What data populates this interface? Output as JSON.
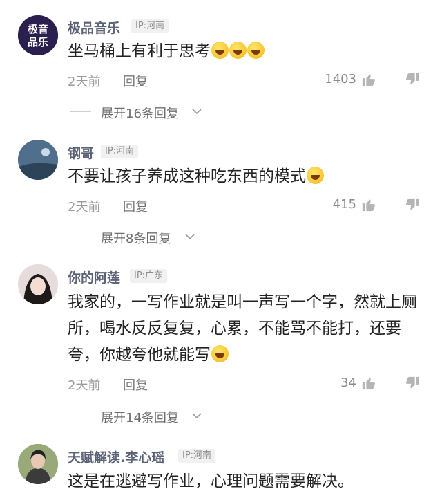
{
  "comments": [
    {
      "username": "极品音乐",
      "ip": "IP:河南",
      "text": "坐马桶上有利于思考",
      "emoji_count": 3,
      "time": "2天前",
      "reply_label": "回复",
      "likes": "1403",
      "expand_label": "展开16条回复",
      "avatar": {
        "line1": "极音",
        "line2": "品乐"
      }
    },
    {
      "username": "钢哥",
      "ip": "IP:河南",
      "text": "不要让孩子养成这种吃东西的模式",
      "emoji_count": 1,
      "time": "2天前",
      "reply_label": "回复",
      "likes": "415",
      "expand_label": "展开8条回复"
    },
    {
      "username": "你的阿莲",
      "ip": "IP:广东",
      "text": "我家的，一写作业就是叫一声写一个字，然就上厕所，喝水反反复复，心累，不能骂不能打，还要夸，你越夸他就能写",
      "emoji_count": 1,
      "time": "2天前",
      "reply_label": "回复",
      "likes": "34",
      "expand_label": "展开14条回复"
    },
    {
      "username": "天赋解读.李心瑶",
      "ip": "IP:河南",
      "text": "这是在逃避写作业，心理问题需要解决。"
    }
  ],
  "colors": {
    "username": "#5b6275",
    "text": "#222222",
    "meta": "#9a9a9a",
    "emoji": "#f6b615"
  },
  "icons": {
    "like": "thumbs-up-icon",
    "dislike": "thumbs-down-icon",
    "expand": "chevron-down-icon"
  }
}
